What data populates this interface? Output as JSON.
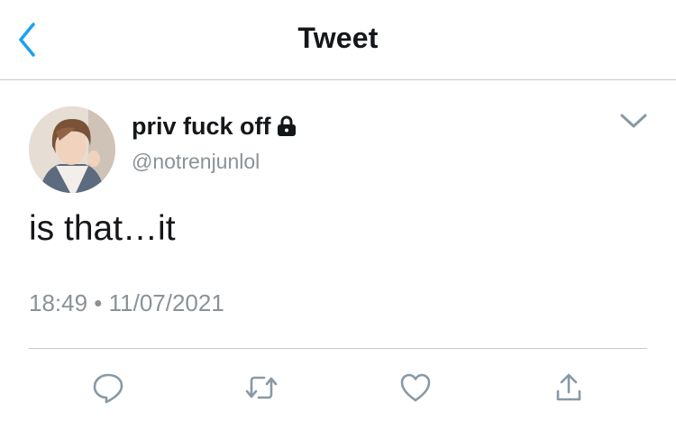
{
  "header": {
    "title": "Tweet",
    "back_icon": "chevron-left-icon"
  },
  "tweet": {
    "display_name": "priv fuck off",
    "handle": "@notrenjunlol",
    "text": "is that…it",
    "timestamp": "18:49 • 11/07/2021",
    "protected_icon": "lock-icon",
    "menu_icon": "chevron-down-icon"
  },
  "actions": [
    {
      "name": "reply",
      "icon": "speech-bubble-icon"
    },
    {
      "name": "retweet",
      "icon": "retweet-icon"
    },
    {
      "name": "like",
      "icon": "heart-icon"
    },
    {
      "name": "share",
      "icon": "share-icon"
    }
  ],
  "colors": {
    "accent": "#1da1f2",
    "text_primary": "#14171a",
    "text_secondary": "#8a9298",
    "icon_gray": "#8899a6",
    "divider": "#c8c8cc"
  }
}
